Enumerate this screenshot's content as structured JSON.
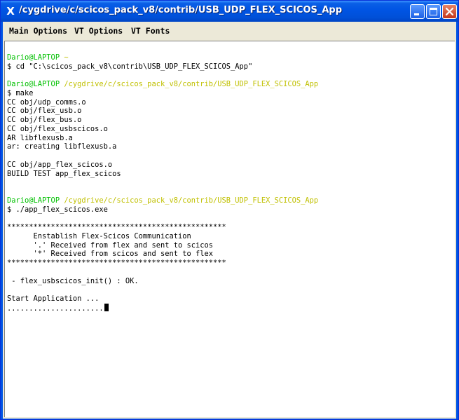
{
  "window": {
    "title": "/cygdrive/c/scicos_pack_v8/contrib/USB_UDP_FLEX_SCICOS_App",
    "app_icon": "x-icon",
    "controls": [
      "minimize-icon",
      "maximize-icon",
      "close-icon"
    ]
  },
  "menu": {
    "items": [
      "Main Options",
      "VT Options",
      "VT Fonts"
    ]
  },
  "terminal": {
    "lines": [
      {
        "parts": [
          {
            "text": "",
            "color": "black"
          }
        ]
      },
      {
        "parts": [
          {
            "text": "Dario@LAPTOP ",
            "color": "green"
          },
          {
            "text": "~",
            "color": "yellow"
          }
        ]
      },
      {
        "parts": [
          {
            "text": "$ cd \"C:\\scicos_pack_v8\\contrib\\USB_UDP_FLEX_SCICOS_App\"",
            "color": "black"
          }
        ]
      },
      {
        "parts": [
          {
            "text": "",
            "color": "black"
          }
        ]
      },
      {
        "parts": [
          {
            "text": "Dario@LAPTOP ",
            "color": "green"
          },
          {
            "text": "/cygdrive/c/scicos_pack_v8/contrib/USB_UDP_FLEX_SCICOS_App",
            "color": "yellow"
          }
        ]
      },
      {
        "parts": [
          {
            "text": "$ make",
            "color": "black"
          }
        ]
      },
      {
        "parts": [
          {
            "text": "CC obj/udp_comms.o",
            "color": "black"
          }
        ]
      },
      {
        "parts": [
          {
            "text": "CC obj/flex_usb.o",
            "color": "black"
          }
        ]
      },
      {
        "parts": [
          {
            "text": "CC obj/flex_bus.o",
            "color": "black"
          }
        ]
      },
      {
        "parts": [
          {
            "text": "CC obj/flex_usbscicos.o",
            "color": "black"
          }
        ]
      },
      {
        "parts": [
          {
            "text": "AR libflexusb.a",
            "color": "black"
          }
        ]
      },
      {
        "parts": [
          {
            "text": "ar: creating libflexusb.a",
            "color": "black"
          }
        ]
      },
      {
        "parts": [
          {
            "text": "",
            "color": "black"
          }
        ]
      },
      {
        "parts": [
          {
            "text": "CC obj/app_flex_scicos.o",
            "color": "black"
          }
        ]
      },
      {
        "parts": [
          {
            "text": "BUILD TEST app_flex_scicos",
            "color": "black"
          }
        ]
      },
      {
        "parts": [
          {
            "text": "",
            "color": "black"
          }
        ]
      },
      {
        "parts": [
          {
            "text": "",
            "color": "black"
          }
        ]
      },
      {
        "parts": [
          {
            "text": "Dario@LAPTOP ",
            "color": "green"
          },
          {
            "text": "/cygdrive/c/scicos_pack_v8/contrib/USB_UDP_FLEX_SCICOS_App",
            "color": "yellow"
          }
        ]
      },
      {
        "parts": [
          {
            "text": "$ ./app_flex_scicos.exe",
            "color": "black"
          }
        ]
      },
      {
        "parts": [
          {
            "text": "",
            "color": "black"
          }
        ]
      },
      {
        "parts": [
          {
            "text": "**************************************************",
            "color": "black"
          }
        ]
      },
      {
        "parts": [
          {
            "text": "      Enstablish Flex-Scicos Communication",
            "color": "black"
          }
        ]
      },
      {
        "parts": [
          {
            "text": "      '.' Received from flex and sent to scicos",
            "color": "black"
          }
        ]
      },
      {
        "parts": [
          {
            "text": "      '*' Received from scicos and sent to flex",
            "color": "black"
          }
        ]
      },
      {
        "parts": [
          {
            "text": "**************************************************",
            "color": "black"
          }
        ]
      },
      {
        "parts": [
          {
            "text": "",
            "color": "black"
          }
        ]
      },
      {
        "parts": [
          {
            "text": " - flex_usbscicos_init() : OK.",
            "color": "black"
          }
        ]
      },
      {
        "parts": [
          {
            "text": "",
            "color": "black"
          }
        ]
      },
      {
        "parts": [
          {
            "text": "Start Application ...",
            "color": "black"
          }
        ]
      },
      {
        "parts": [
          {
            "text": "......................",
            "color": "black"
          }
        ],
        "cursor": true
      }
    ]
  }
}
